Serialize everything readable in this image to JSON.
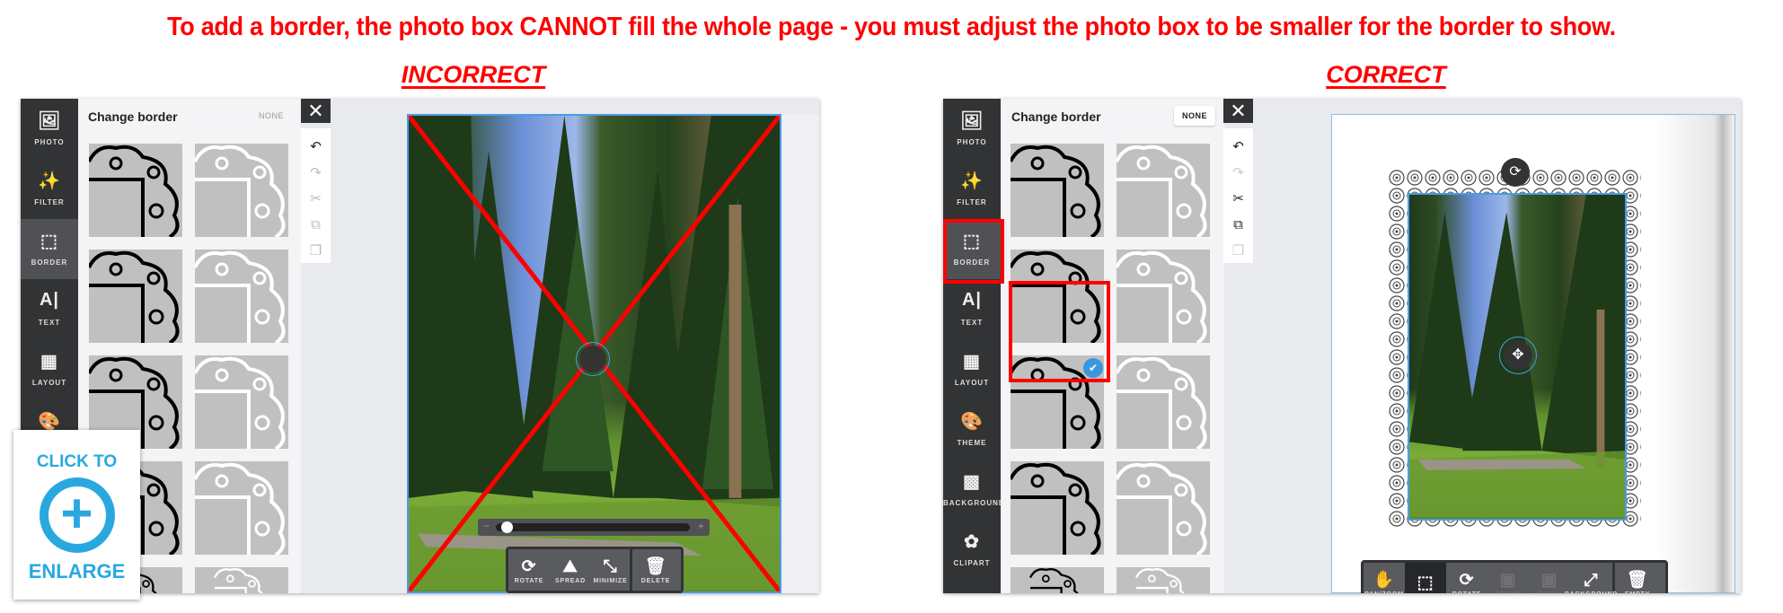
{
  "headline": "To add a border, the photo box CANNOT fill the whole page - you must adjust the photo box to be smaller for the border to show.",
  "incorrect_label": "INCORRECT",
  "correct_label": "CORRECT",
  "enlarge": {
    "top": "CLICK TO",
    "bottom": "ENLARGE",
    "icon": "plus-circle-icon",
    "color": "#29a8e0"
  },
  "accent": "#f00",
  "panel": {
    "title": "Change border",
    "none_label": "NONE"
  },
  "sidebar_left": [
    {
      "label": "PHOTO",
      "icon": "photo-icon"
    },
    {
      "label": "FILTER",
      "icon": "magic-wand-icon"
    },
    {
      "label": "BORDER",
      "icon": "border-icon",
      "active": true
    },
    {
      "label": "TEXT",
      "icon": "text-icon"
    },
    {
      "label": "LAYOUT",
      "icon": "layout-icon"
    },
    {
      "label": "THEME",
      "icon": "palette-icon"
    }
  ],
  "sidebar_right": [
    {
      "label": "PHOTO",
      "icon": "photo-icon"
    },
    {
      "label": "FILTER",
      "icon": "magic-wand-icon"
    },
    {
      "label": "BORDER",
      "icon": "border-icon",
      "active": true
    },
    {
      "label": "TEXT",
      "icon": "text-icon"
    },
    {
      "label": "LAYOUT",
      "icon": "layout-icon"
    },
    {
      "label": "THEME",
      "icon": "palette-icon"
    },
    {
      "label": "BACKGROUND",
      "icon": "background-icon"
    },
    {
      "label": "CLIPART",
      "icon": "flower-icon"
    }
  ],
  "toolbar_left": [
    {
      "label": "ROTATE",
      "icon": "rotate-icon"
    },
    {
      "label": "SPREAD",
      "icon": "spread-icon"
    },
    {
      "label": "MINIMIZE",
      "icon": "minimize-icon"
    },
    {
      "label": "DELETE",
      "icon": "trash-icon"
    }
  ],
  "toolbar_right": [
    {
      "label": "PAN/ZOOM",
      "icon": "hand-icon"
    },
    {
      "label": "",
      "icon": "crop-select-icon"
    },
    {
      "label": "ROTATE",
      "icon": "rotate-icon"
    },
    {
      "label": "FRONT",
      "icon": "bring-front-icon",
      "disabled": true
    },
    {
      "label": "BACK",
      "icon": "send-back-icon",
      "disabled": true
    },
    {
      "label": "BACKGROUND",
      "icon": "expand-icon"
    },
    {
      "label": "EMPTY",
      "icon": "trash-icon"
    }
  ],
  "slider": {
    "minus": "−",
    "plus": "+",
    "value": 0.03
  },
  "selected_border": "row3-col1"
}
